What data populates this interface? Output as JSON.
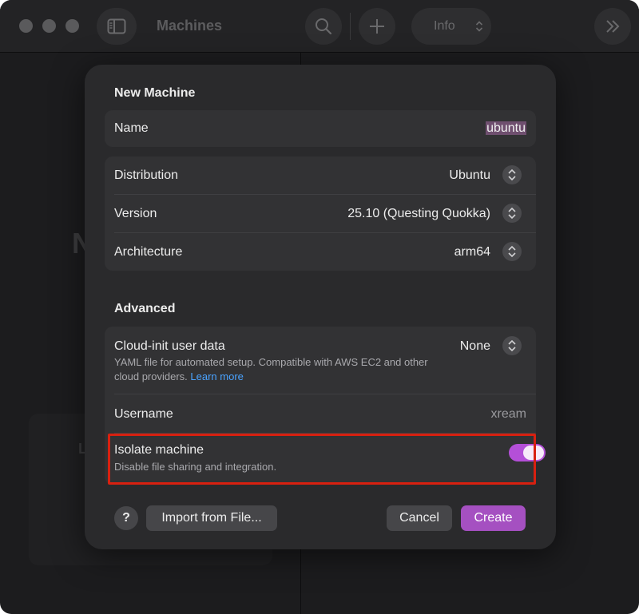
{
  "toolbar": {
    "title": "Machines",
    "info_label": "Info"
  },
  "background": {
    "partial_letter_large": "N",
    "partial_letter_small": "L"
  },
  "dialog": {
    "title": "New Machine",
    "name_label": "Name",
    "name_value": "ubuntu",
    "distribution_label": "Distribution",
    "distribution_value": "Ubuntu",
    "version_label": "Version",
    "version_value": "25.10 (Questing Quokka)",
    "architecture_label": "Architecture",
    "architecture_value": "arm64",
    "advanced_title": "Advanced",
    "cloudinit_label": "Cloud-init user data",
    "cloudinit_value": "None",
    "cloudinit_desc": "YAML file for automated setup. Compatible with AWS EC2 and other cloud providers.",
    "cloudinit_link": "Learn more",
    "username_label": "Username",
    "username_placeholder": "xream",
    "isolate_label": "Isolate machine",
    "isolate_desc": "Disable file sharing and integration.",
    "isolate_on": true,
    "help_label": "?",
    "import_label": "Import from File...",
    "cancel_label": "Cancel",
    "create_label": "Create"
  },
  "colors": {
    "accent": "#a550c1",
    "toggle_on": "#b44fd8",
    "link": "#4aa3ff",
    "highlight_box": "#d82010"
  }
}
